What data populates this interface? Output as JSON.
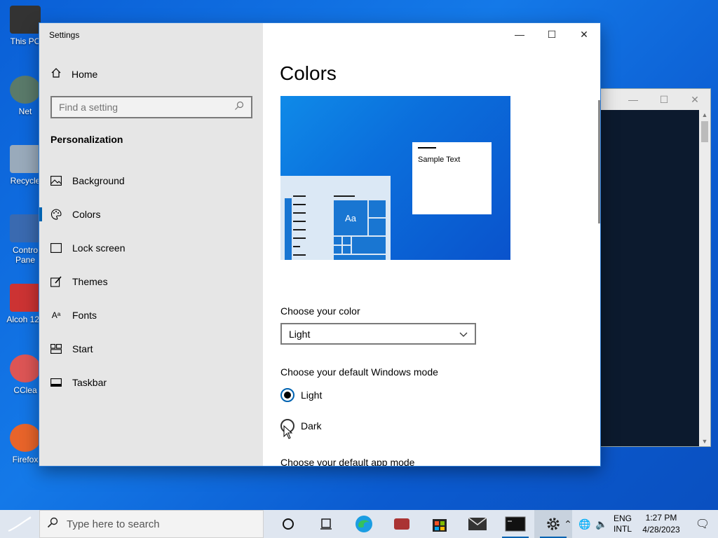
{
  "desktop": {
    "icons": [
      {
        "label": "This PC"
      },
      {
        "label": "Net"
      },
      {
        "label": "Recycle"
      },
      {
        "label": "Contro Pane"
      },
      {
        "label": "Alcoh 120"
      },
      {
        "label": "CClea"
      },
      {
        "label": "Firefox"
      }
    ]
  },
  "settings": {
    "window_title": "Settings",
    "nav": {
      "home": "Home",
      "search_placeholder": "Find a setting",
      "section": "Personalization",
      "items": [
        {
          "label": "Background",
          "icon": "image-icon"
        },
        {
          "label": "Colors",
          "icon": "palette-icon",
          "active": true
        },
        {
          "label": "Lock screen",
          "icon": "lock-screen-icon"
        },
        {
          "label": "Themes",
          "icon": "brush-icon"
        },
        {
          "label": "Fonts",
          "icon": "font-icon"
        },
        {
          "label": "Start",
          "icon": "start-icon"
        },
        {
          "label": "Taskbar",
          "icon": "taskbar-icon"
        }
      ]
    },
    "page": {
      "title": "Colors",
      "preview": {
        "sample_text": "Sample Text",
        "tile_text": "Aa"
      },
      "choose_color_label": "Choose your color",
      "choose_color_value": "Light",
      "windows_mode_label": "Choose your default Windows mode",
      "windows_mode_options": [
        {
          "label": "Light",
          "selected": true
        },
        {
          "label": "Dark",
          "selected": false
        }
      ],
      "app_mode_label": "Choose your default app mode"
    },
    "accent_color": "#0063b1"
  },
  "taskbar": {
    "search_placeholder": "Type here to search",
    "lang_line1": "ENG",
    "lang_line2": "INTL",
    "time": "1:27 PM",
    "date": "4/28/2023"
  }
}
